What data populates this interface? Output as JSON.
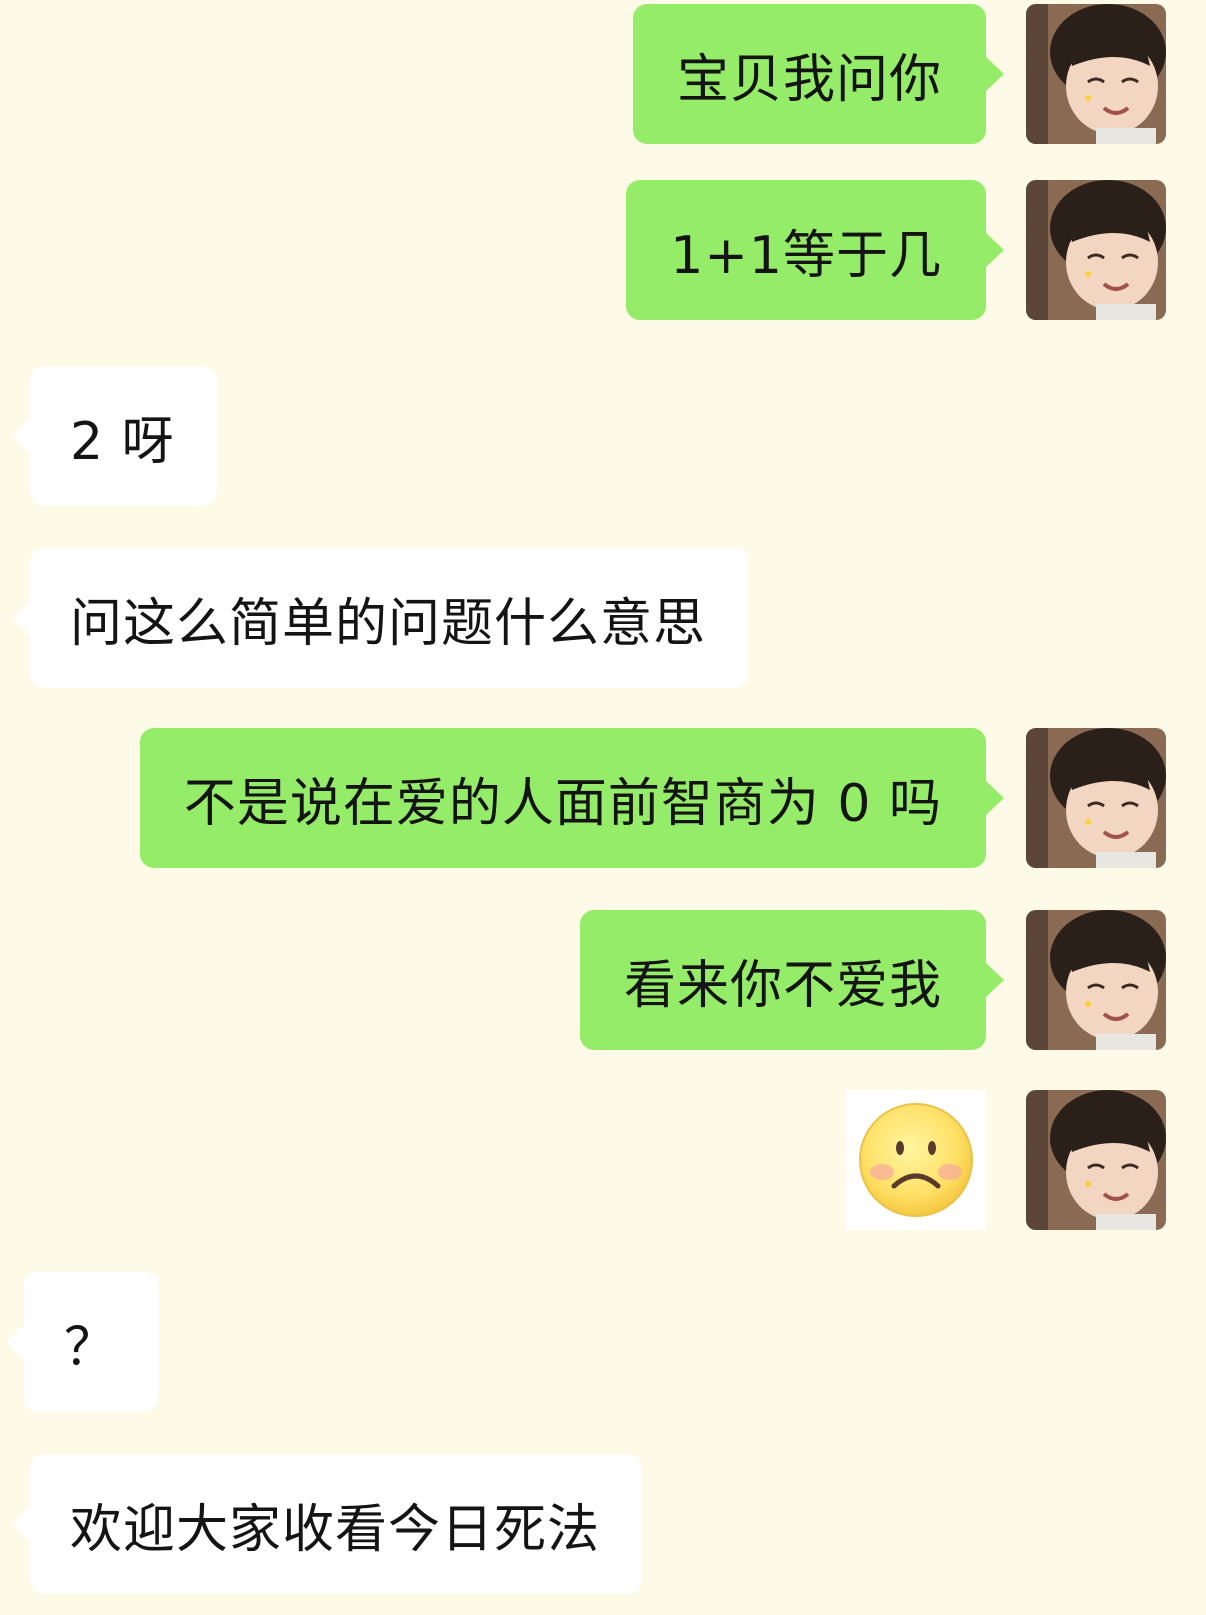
{
  "chat": {
    "messages": [
      {
        "side": "out",
        "text": "宝贝我问你"
      },
      {
        "side": "out",
        "text": "1+1等于几"
      },
      {
        "side": "in",
        "text": "2 呀"
      },
      {
        "side": "in",
        "text": "问这么简单的问题什么意思"
      },
      {
        "side": "out",
        "text": "不是说在爱的人面前智商为 0 吗"
      },
      {
        "side": "out",
        "text": "看来你不爱我"
      },
      {
        "side": "out",
        "sticker": "sad-face-emoji"
      },
      {
        "side": "in",
        "text": "？"
      },
      {
        "side": "in",
        "text": "欢迎大家收看今日死法"
      }
    ]
  },
  "colors": {
    "background": "#fdfbe8",
    "outgoing_bubble": "#95ec69",
    "incoming_bubble": "#ffffff",
    "text": "#141414"
  }
}
